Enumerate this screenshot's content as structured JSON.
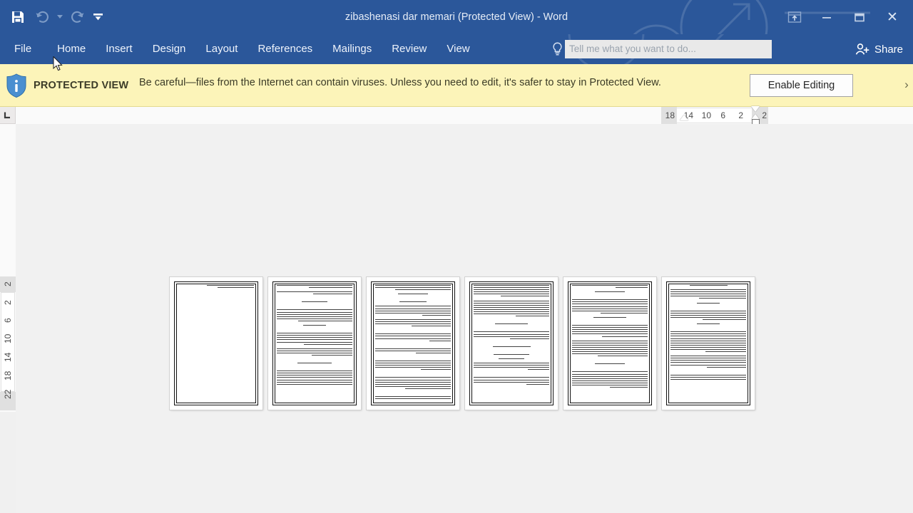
{
  "window": {
    "title": "zibashenasi dar memari (Protected View) - Word",
    "minimize_label": "–",
    "restore_label": "❐",
    "close_label": "✕",
    "ribbon_display_options_tooltip": "Ribbon Display Options"
  },
  "quick_access": {
    "save_label": "save-icon",
    "undo_label": "undo-icon",
    "undo_caret_label": "▼",
    "redo_label": "redo-icon",
    "customize_label": "▼"
  },
  "ribbon": {
    "tabs": [
      {
        "label": "File",
        "active": false
      },
      {
        "label": "Home",
        "active": false
      },
      {
        "label": "Insert",
        "active": false
      },
      {
        "label": "Design",
        "active": false
      },
      {
        "label": "Layout",
        "active": false
      },
      {
        "label": "References",
        "active": false
      },
      {
        "label": "Mailings",
        "active": false
      },
      {
        "label": "Review",
        "active": false
      },
      {
        "label": "View",
        "active": false
      }
    ],
    "tellme_placeholder": "Tell me what you want to do...",
    "tellme_value": "",
    "share_label": "Share"
  },
  "protected_view": {
    "badge": "PROTECTED VIEW",
    "message": "Be careful—files from the Internet can contain viruses. Unless you need to edit, it's safer to stay in Protected View.",
    "enable_button": "Enable Editing",
    "close_label": "›",
    "background_color": "#fcf4b9"
  },
  "ruler": {
    "horizontal_numbers": [
      "18",
      "14",
      "10",
      "6",
      "2",
      "2"
    ],
    "vertical_numbers": [
      "2",
      "2",
      "6",
      "10",
      "14",
      "18",
      "22"
    ],
    "tab_stop_selector": "left-tab-icon",
    "unit": "cm"
  },
  "document": {
    "zoom_view": "multiple-pages",
    "page_count": 6,
    "direction": "rtl",
    "pages": [
      {
        "number": 1,
        "paragraphs": [
          {
            "align": "right",
            "gap": true,
            "lines": [
              62,
              48
            ]
          }
        ]
      },
      {
        "number": 2,
        "paragraphs": [
          {
            "align": "justify",
            "lines": [
              100,
              58
            ]
          },
          {
            "align": "justify",
            "gap": true,
            "lines": [
              100,
              52
            ]
          },
          {
            "align": "center",
            "gap": true,
            "lines": [
              34
            ]
          },
          {
            "align": "justify",
            "lines": [
              100,
              100,
              100,
              100,
              100,
              72
            ]
          },
          {
            "align": "center",
            "gap": true,
            "lines": [
              30
            ]
          },
          {
            "align": "justify",
            "lines": [
              100,
              100,
              100,
              100,
              100,
              64
            ]
          },
          {
            "align": "justify",
            "gap": true,
            "lines": [
              100,
              100,
              100,
              54
            ]
          },
          {
            "align": "center",
            "gap": true,
            "lines": [
              46
            ]
          },
          {
            "align": "justify",
            "lines": [
              100,
              100,
              100,
              100,
              100,
              100,
              100
            ]
          }
        ]
      },
      {
        "number": 3,
        "paragraphs": [
          {
            "align": "justify",
            "lines": [
              100,
              100,
              74
            ]
          },
          {
            "align": "center",
            "gap": true,
            "lines": [
              40
            ]
          },
          {
            "align": "center",
            "lines": [
              36
            ]
          },
          {
            "align": "justify",
            "lines": [
              100,
              100,
              100,
              100,
              38
            ]
          },
          {
            "align": "justify",
            "gap": true,
            "lines": [
              100,
              100,
              100,
              52
            ]
          },
          {
            "align": "justify",
            "gap": true,
            "lines": [
              100,
              100,
              100,
              28
            ]
          },
          {
            "align": "justify",
            "gap": true,
            "lines": [
              100,
              100,
              46
            ]
          },
          {
            "align": "justify",
            "gap": true,
            "lines": [
              100,
              100,
              100,
              100,
              40
            ]
          },
          {
            "align": "justify",
            "gap": true,
            "lines": [
              100,
              100,
              100,
              100,
              100,
              60
            ]
          },
          {
            "align": "justify",
            "lines": [
              100,
              100
            ]
          }
        ]
      },
      {
        "number": 4,
        "paragraphs": [
          {
            "align": "justify",
            "lines": [
              100,
              100,
              100,
              100,
              100,
              64
            ]
          },
          {
            "align": "justify",
            "gap": true,
            "lines": [
              100,
              100,
              100,
              100,
              100,
              100,
              100,
              44
            ]
          },
          {
            "align": "center",
            "gap": true,
            "lines": [
              44
            ]
          },
          {
            "align": "justify",
            "gap": true,
            "lines": [
              100,
              100,
              100,
              52
            ]
          },
          {
            "align": "center",
            "gap": true,
            "lines": [
              50
            ]
          },
          {
            "align": "center",
            "lines": [
              48
            ]
          },
          {
            "align": "center",
            "lines": [
              34
            ]
          },
          {
            "align": "justify",
            "gap": true,
            "lines": [
              100,
              100,
              100,
              28
            ]
          },
          {
            "align": "justify",
            "gap": true,
            "lines": [
              100,
              100,
              100,
              30
            ]
          }
        ]
      },
      {
        "number": 5,
        "paragraphs": [
          {
            "align": "justify",
            "lines": [
              100,
              42
            ]
          },
          {
            "align": "center",
            "gap": true,
            "lines": [
              40
            ]
          },
          {
            "align": "justify",
            "lines": [
              100,
              100,
              100,
              100,
              100,
              100,
              62
            ]
          },
          {
            "align": "center",
            "gap": true,
            "lines": [
              44
            ]
          },
          {
            "align": "justify",
            "lines": [
              100,
              100,
              100,
              100,
              100,
              60
            ]
          },
          {
            "align": "justify",
            "gap": true,
            "lines": [
              100,
              100,
              100,
              100,
              100,
              100,
              100,
              66
            ]
          },
          {
            "align": "center",
            "gap": true,
            "lines": [
              40
            ]
          },
          {
            "align": "justify",
            "lines": [
              100,
              100,
              100,
              100,
              100,
              100,
              100,
              50
            ]
          }
        ]
      },
      {
        "number": 6,
        "paragraphs": [
          {
            "align": "center",
            "lines": [
              50
            ]
          },
          {
            "align": "justify",
            "lines": [
              100,
              100,
              100,
              100,
              62
            ]
          },
          {
            "align": "center",
            "gap": true,
            "lines": [
              30
            ]
          },
          {
            "align": "justify",
            "lines": [
              100,
              100,
              100,
              100,
              58
            ]
          },
          {
            "align": "center",
            "gap": true,
            "lines": [
              30
            ]
          },
          {
            "align": "justify",
            "lines": [
              100,
              100,
              100,
              100,
              100,
              100,
              100,
              100,
              100,
              54
            ]
          },
          {
            "align": "justify",
            "gap": true,
            "lines": [
              100,
              100,
              100,
              100,
              100,
              52
            ]
          },
          {
            "align": "justify",
            "gap": true,
            "lines": [
              100,
              100,
              100
            ]
          }
        ]
      }
    ]
  },
  "theme": {
    "title_bar": "#2b579a",
    "ribbon_bar": "#2b579a",
    "canvas": "#f1f1f1",
    "protected_bar": "#fcf4b9",
    "ruler": "#fafafa"
  }
}
